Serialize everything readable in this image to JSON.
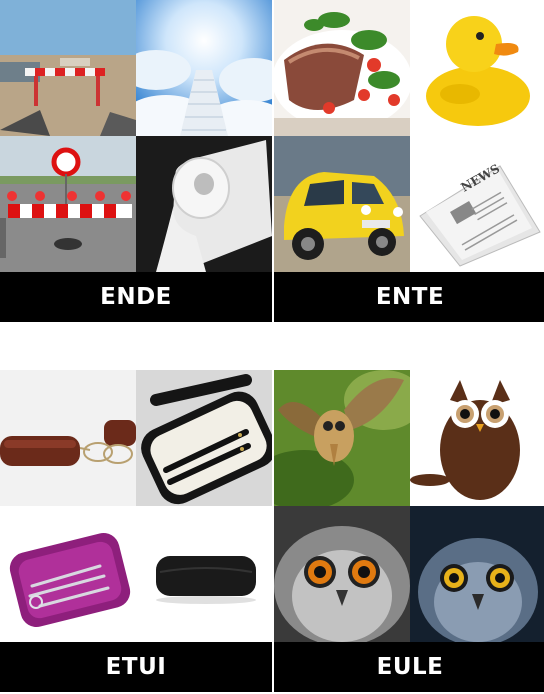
{
  "puzzles": [
    {
      "word": "ENDE",
      "images": [
        {
          "icon": "road-barrier-icon"
        },
        {
          "icon": "stairway-to-heaven-icon"
        },
        {
          "icon": "road-closed-barrier-icon"
        },
        {
          "icon": "toilet-paper-roll-icon"
        }
      ]
    },
    {
      "word": "ENTE",
      "images": [
        {
          "icon": "duck-breast-dish-icon"
        },
        {
          "icon": "rubber-duck-icon"
        },
        {
          "icon": "yellow-citroen-2cv-car-icon"
        },
        {
          "icon": "newspaper-icon"
        }
      ]
    },
    {
      "word": "ETUI",
      "images": [
        {
          "icon": "leather-glasses-case-icon"
        },
        {
          "icon": "pen-case-icon"
        },
        {
          "icon": "manicure-set-case-icon"
        },
        {
          "icon": "black-glasses-case-icon"
        }
      ]
    },
    {
      "word": "EULE",
      "images": [
        {
          "icon": "flying-owl-icon"
        },
        {
          "icon": "coffee-bean-owl-icon"
        },
        {
          "icon": "grey-owl-closeup-icon"
        },
        {
          "icon": "blue-owl-closeup-icon"
        }
      ]
    }
  ],
  "colors": {
    "label_bg": "#000000",
    "label_text": "#ffffff"
  }
}
